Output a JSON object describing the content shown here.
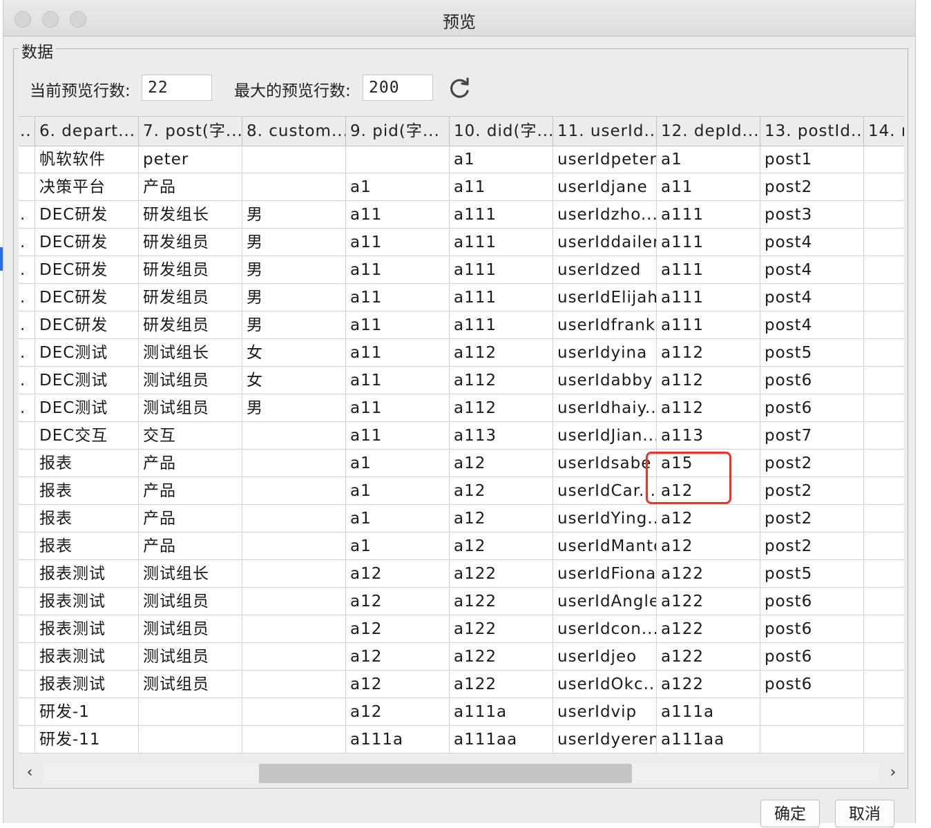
{
  "window": {
    "title": "预览"
  },
  "group": {
    "title": "数据"
  },
  "controls": {
    "current_rows_label": "当前预览行数:",
    "current_rows_value": "22",
    "max_rows_label": "最大的预览行数:",
    "max_rows_value": "200"
  },
  "table": {
    "columns": [
      "..",
      "6. depart...",
      "7. post(字...",
      "8. custom...",
      "9. pid(字...",
      "10. did(字...",
      "11. userId...",
      "12. depId...",
      "13. postId...",
      "14. r"
    ],
    "rows": [
      [
        "",
        "帆软软件",
        "peter",
        "",
        "",
        "a1",
        "userIdpeter",
        "a1",
        "post1",
        ""
      ],
      [
        "",
        "决策平台",
        "产品",
        "",
        "a1",
        "a11",
        "userIdjane",
        "a11",
        "post2",
        ""
      ],
      [
        ".",
        "DEC研发",
        "研发组长",
        "男",
        "a11",
        "a111",
        "userIdzho...",
        "a111",
        "post3",
        ""
      ],
      [
        ".",
        "DEC研发",
        "研发组员",
        "男",
        "a11",
        "a111",
        "userIddailer",
        "a111",
        "post4",
        ""
      ],
      [
        ".",
        "DEC研发",
        "研发组员",
        "男",
        "a11",
        "a111",
        "userIdzed",
        "a111",
        "post4",
        ""
      ],
      [
        ".",
        "DEC研发",
        "研发组员",
        "男",
        "a11",
        "a111",
        "userIdElijah",
        "a111",
        "post4",
        ""
      ],
      [
        ".",
        "DEC研发",
        "研发组员",
        "男",
        "a11",
        "a111",
        "userIdfrank",
        "a111",
        "post4",
        ""
      ],
      [
        ".",
        "DEC测试",
        "测试组长",
        "女",
        "a11",
        "a112",
        "userIdyina",
        "a112",
        "post5",
        ""
      ],
      [
        ".",
        "DEC测试",
        "测试组员",
        "女",
        "a11",
        "a112",
        "userIdabby",
        "a112",
        "post6",
        ""
      ],
      [
        ".",
        "DEC测试",
        "测试组员",
        "男",
        "a11",
        "a112",
        "userIdhaiy...",
        "a112",
        "post6",
        ""
      ],
      [
        "",
        "DEC交互",
        "交互",
        "",
        "a11",
        "a113",
        "userIdJian...",
        "a113",
        "post7",
        ""
      ],
      [
        "",
        "报表",
        "产品",
        "",
        "a1",
        "a12",
        "userIdsabe",
        "a15",
        "post2",
        ""
      ],
      [
        "",
        "报表",
        "产品",
        "",
        "a1",
        "a12",
        "userIdCar...",
        "a12",
        "post2",
        ""
      ],
      [
        "",
        "报表",
        "产品",
        "",
        "a1",
        "a12",
        "userIdYing...",
        "a12",
        "post2",
        ""
      ],
      [
        "",
        "报表",
        "产品",
        "",
        "a1",
        "a12",
        "userIdManto",
        "a12",
        "post2",
        ""
      ],
      [
        "",
        "报表测试",
        "测试组长",
        "",
        "a12",
        "a122",
        "userIdFiona",
        "a122",
        "post5",
        ""
      ],
      [
        "",
        "报表测试",
        "测试组员",
        "",
        "a12",
        "a122",
        "userIdAngle",
        "a122",
        "post6",
        ""
      ],
      [
        "",
        "报表测试",
        "测试组员",
        "",
        "a12",
        "a122",
        "userIdcon...",
        "a122",
        "post6",
        ""
      ],
      [
        "",
        "报表测试",
        "测试组员",
        "",
        "a12",
        "a122",
        "userIdjeo",
        "a122",
        "post6",
        ""
      ],
      [
        "",
        "报表测试",
        "测试组员",
        "",
        "a12",
        "a122",
        "userIdOkc...",
        "a122",
        "post6",
        ""
      ],
      [
        "",
        "研发-1",
        "",
        "",
        "a12",
        "a111a",
        "userIdvip",
        "a111a",
        "",
        ""
      ],
      [
        "",
        "研发-11",
        "",
        "",
        "a111a",
        "a111aa",
        "userIdyeren",
        "a111aa",
        "",
        ""
      ]
    ]
  },
  "scrollbar": {
    "left_arrow": "‹",
    "right_arrow": "›"
  },
  "buttons": {
    "ok": "确定",
    "cancel": "取消"
  },
  "colors": {
    "highlight": "#e8332a",
    "window_bg": "#ececec"
  }
}
